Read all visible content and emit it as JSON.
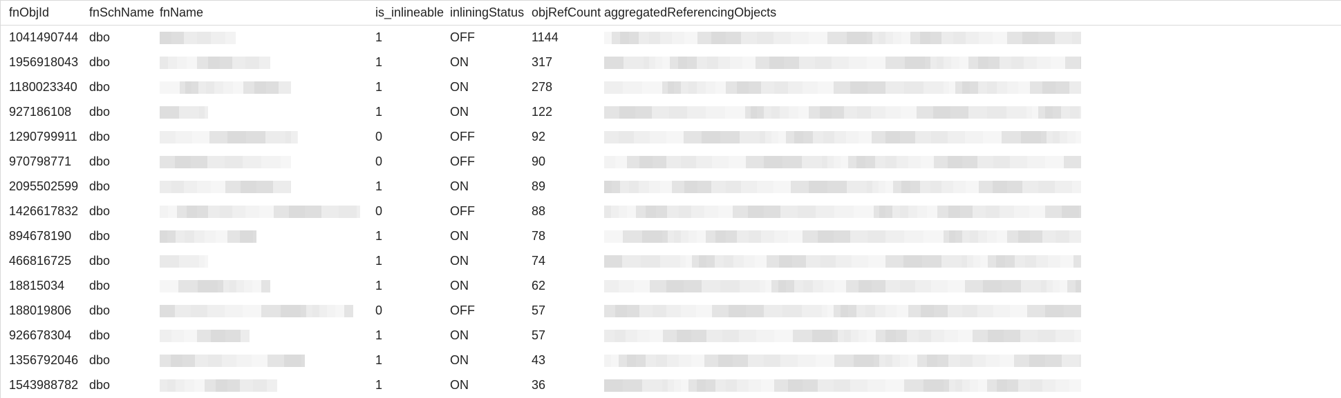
{
  "columns": {
    "fnObjId": "fnObjId",
    "fnSchName": "fnSchName",
    "fnName": "fnName",
    "is_inlineable": "is_inlineable",
    "inliningStatus": "inliningStatus",
    "objRefCount": "objRefCount",
    "aggregatedReferencingObjects": "aggregatedReferencingObjects"
  },
  "rows": [
    {
      "fnObjId": "1041490744",
      "fnSchName": "dbo",
      "is_inlineable": "1",
      "inliningStatus": "OFF",
      "objRefCount": "1144"
    },
    {
      "fnObjId": "1956918043",
      "fnSchName": "dbo",
      "is_inlineable": "1",
      "inliningStatus": "ON",
      "objRefCount": "317"
    },
    {
      "fnObjId": "1180023340",
      "fnSchName": "dbo",
      "is_inlineable": "1",
      "inliningStatus": "ON",
      "objRefCount": "278"
    },
    {
      "fnObjId": "927186108",
      "fnSchName": "dbo",
      "is_inlineable": "1",
      "inliningStatus": "ON",
      "objRefCount": "122"
    },
    {
      "fnObjId": "1290799911",
      "fnSchName": "dbo",
      "is_inlineable": "0",
      "inliningStatus": "OFF",
      "objRefCount": "92"
    },
    {
      "fnObjId": "970798771",
      "fnSchName": "dbo",
      "is_inlineable": "0",
      "inliningStatus": "OFF",
      "objRefCount": "90"
    },
    {
      "fnObjId": "2095502599",
      "fnSchName": "dbo",
      "is_inlineable": "1",
      "inliningStatus": "ON",
      "objRefCount": "89"
    },
    {
      "fnObjId": "1426617832",
      "fnSchName": "dbo",
      "is_inlineable": "0",
      "inliningStatus": "OFF",
      "objRefCount": "88"
    },
    {
      "fnObjId": "894678190",
      "fnSchName": "dbo",
      "is_inlineable": "1",
      "inliningStatus": "ON",
      "objRefCount": "78"
    },
    {
      "fnObjId": "466816725",
      "fnSchName": "dbo",
      "is_inlineable": "1",
      "inliningStatus": "ON",
      "objRefCount": "74"
    },
    {
      "fnObjId": "18815034",
      "fnSchName": "dbo",
      "is_inlineable": "1",
      "inliningStatus": "ON",
      "objRefCount": "62"
    },
    {
      "fnObjId": "188019806",
      "fnSchName": "dbo",
      "is_inlineable": "0",
      "inliningStatus": "OFF",
      "objRefCount": "57"
    },
    {
      "fnObjId": "926678304",
      "fnSchName": "dbo",
      "is_inlineable": "1",
      "inliningStatus": "ON",
      "objRefCount": "57"
    },
    {
      "fnObjId": "1356792046",
      "fnSchName": "dbo",
      "is_inlineable": "1",
      "inliningStatus": "ON",
      "objRefCount": "43"
    },
    {
      "fnObjId": "1543988782",
      "fnSchName": "dbo",
      "is_inlineable": "1",
      "inliningStatus": "ON",
      "objRefCount": "36"
    }
  ],
  "redacted_palette": [
    "#e4e4e4",
    "#ececec",
    "#f3f3f3",
    "#dbdbdb",
    "#e9e9e9",
    "#f6f6f6",
    "#dedede",
    "#efefef"
  ]
}
